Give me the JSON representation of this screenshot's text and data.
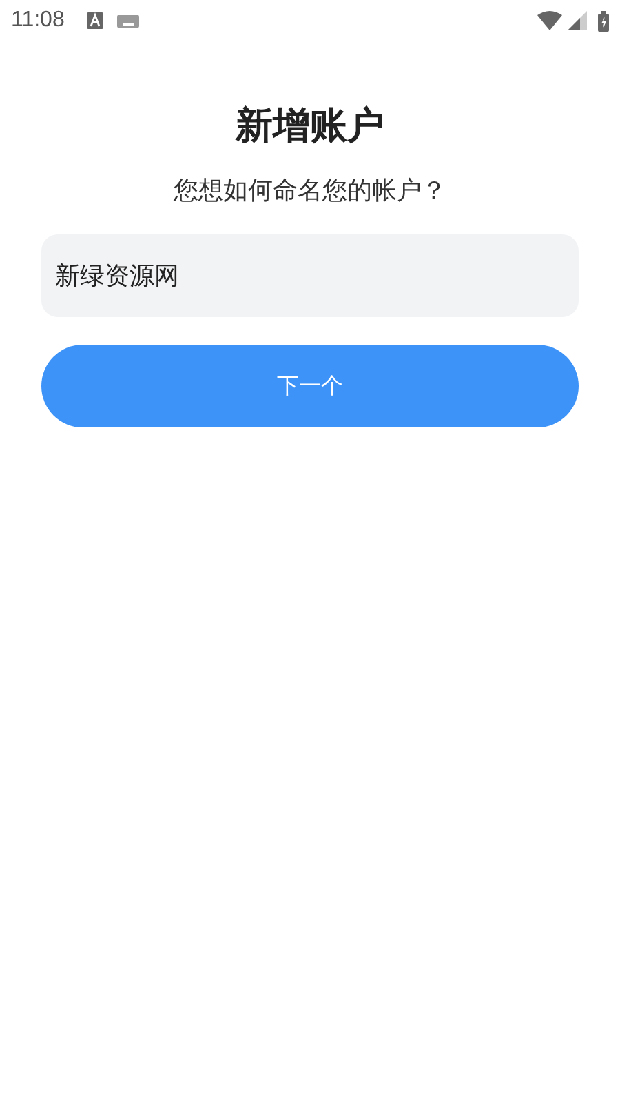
{
  "status_bar": {
    "time": "11:08"
  },
  "title": "新增账户",
  "prompt": "您想如何命名您的帐户？",
  "name_field": {
    "value": "新绿资源网"
  },
  "next_button": {
    "label": "下一个"
  }
}
